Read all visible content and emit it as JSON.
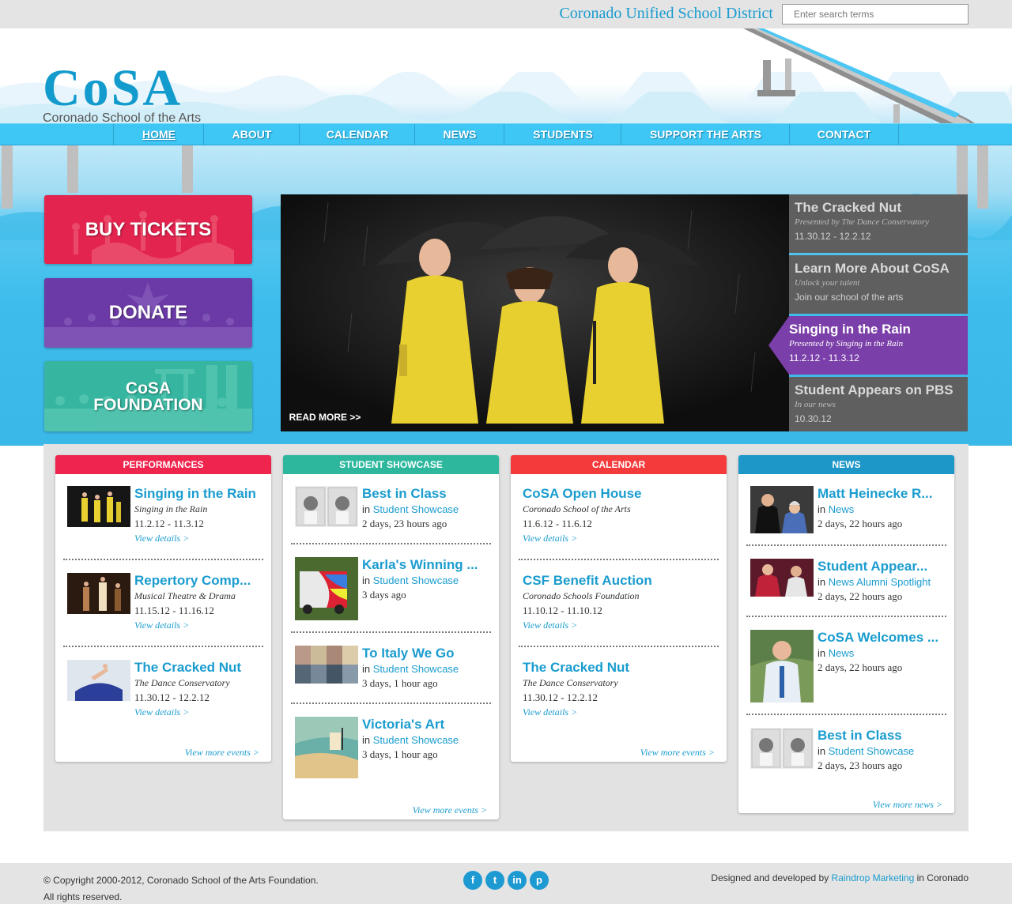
{
  "topbar": {
    "district": "Coronado Unified School District",
    "search_placeholder": "Enter search terms"
  },
  "logo": {
    "title": "CoSA",
    "subtitle": "Coronado School of the Arts"
  },
  "nav": [
    {
      "label": "HOME",
      "active": true
    },
    {
      "label": "ABOUT"
    },
    {
      "label": "CALENDAR"
    },
    {
      "label": "NEWS"
    },
    {
      "label": "STUDENTS"
    },
    {
      "label": "SUPPORT THE ARTS"
    },
    {
      "label": "CONTACT"
    }
  ],
  "promos": {
    "tickets": "BUY TICKETS",
    "donate": "DONATE",
    "foundation_line1": "CoSA",
    "foundation_line2": "FOUNDATION"
  },
  "hero": {
    "read_more": "READ MORE >>"
  },
  "slides": [
    {
      "title": "The Cracked Nut",
      "subtitle": "Presented by The Dance Conservatory",
      "date": "11.30.12 - 12.2.12"
    },
    {
      "title": "Learn More About CoSA",
      "subtitle": "Unlock your talent",
      "date": "Join our school of the arts"
    },
    {
      "title": "Singing in the Rain",
      "subtitle": "Presented by Singing in the Rain",
      "date": "11.2.12 - 11.3.12",
      "active": true
    },
    {
      "title": "Student Appears on PBS",
      "subtitle": "In our news",
      "date": "10.30.12"
    }
  ],
  "columns": {
    "performances": {
      "header": "PERFORMANCES",
      "color": "#f0254d",
      "items": [
        {
          "title": "Singing in the Rain",
          "subtitle": "Singing in the Rain",
          "date": "11.2.12 - 11.3.12",
          "link": "View details >"
        },
        {
          "title": "Repertory Comp...",
          "subtitle": "Musical Theatre & Drama",
          "date": "11.15.12 - 11.16.12",
          "link": "View details >"
        },
        {
          "title": "The Cracked Nut",
          "subtitle": "The Dance Conservatory",
          "date": "11.30.12 - 12.2.12",
          "link": "View details >"
        }
      ],
      "more": "View more events >"
    },
    "showcase": {
      "header": "STUDENT SHOWCASE",
      "color": "#2db89e",
      "items": [
        {
          "title": "Best in Class",
          "in": "in",
          "category": "Student Showcase",
          "ago": "2 days, 23 hours ago"
        },
        {
          "title": "Karla's Winning ...",
          "in": "in",
          "category": "Student Showcase",
          "ago": "3 days ago"
        },
        {
          "title": "To Italy We Go",
          "in": "in",
          "category": "Student Showcase",
          "ago": "3 days, 1 hour ago"
        },
        {
          "title": "Victoria's Art",
          "in": "in",
          "category": "Student Showcase",
          "ago": "3 days, 1 hour ago"
        }
      ],
      "more": "View more events >"
    },
    "calendar": {
      "header": "CALENDAR",
      "color": "#f43a3a",
      "items": [
        {
          "title": "CoSA Open House",
          "subtitle": "Coronado School of the Arts",
          "date": "11.6.12 - 11.6.12",
          "link": "View details >"
        },
        {
          "title": "CSF Benefit Auction",
          "subtitle": "Coronado Schools Foundation",
          "date": "11.10.12 - 11.10.12",
          "link": "View details >"
        },
        {
          "title": "The Cracked Nut",
          "subtitle": "The Dance Conservatory",
          "date": "11.30.12 - 12.2.12",
          "link": "View details >"
        }
      ],
      "more": "View more events >"
    },
    "news": {
      "header": "NEWS",
      "color": "#1d97c8",
      "items": [
        {
          "title": "Matt Heinecke R...",
          "in": "in",
          "category": "News",
          "ago": "2 days, 22 hours ago"
        },
        {
          "title": "Student Appear...",
          "in": "in",
          "category": "News Alumni Spotlight",
          "ago": "2 days, 22 hours ago"
        },
        {
          "title": "CoSA Welcomes ...",
          "in": "in",
          "category": "News",
          "ago": "2 days, 22 hours ago"
        },
        {
          "title": "Best in Class",
          "in": "in",
          "category": "Student Showcase",
          "ago": "2 days, 23 hours ago"
        }
      ],
      "more": "View more news >"
    }
  },
  "footer": {
    "copyright": "© Copyright 2000-2012, Coronado School of the Arts Foundation. All rights reserved.",
    "credit_prefix": "Designed and developed by",
    "credit_link": "Raindrop Marketing",
    "credit_suffix": "in Coronado",
    "social": [
      {
        "icon": "facebook-icon",
        "glyph": "f"
      },
      {
        "icon": "twitter-icon",
        "glyph": "t"
      },
      {
        "icon": "linkedin-icon",
        "glyph": "in"
      },
      {
        "icon": "pinterest-icon",
        "glyph": "p"
      }
    ]
  }
}
